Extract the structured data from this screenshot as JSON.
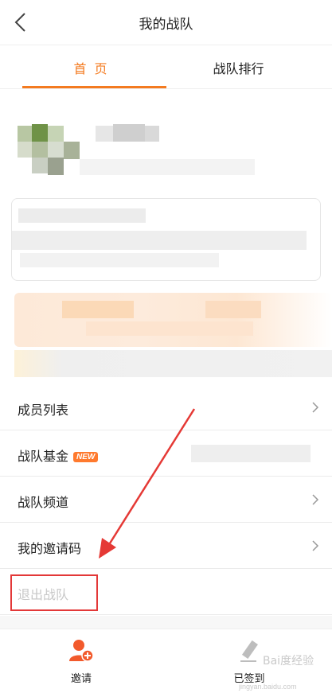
{
  "header": {
    "title": "我的战队"
  },
  "tabs": [
    {
      "label": "首页"
    },
    {
      "label": "战队排行"
    }
  ],
  "menu": {
    "items": [
      {
        "label": "成员列表"
      },
      {
        "label": "战队基金",
        "badge": "NEW"
      },
      {
        "label": "战队频道"
      },
      {
        "label": "我的邀请码"
      },
      {
        "label": "退出战队"
      }
    ]
  },
  "bottom_bar": {
    "invite_label": "邀请",
    "signin_label": "已签到"
  },
  "watermark": {
    "text": "Bai度经验",
    "url": "jingyan.baidu.com"
  },
  "colors": {
    "accent": "#f47b20",
    "highlight_box": "#e33838",
    "arrow": "#e53935"
  }
}
